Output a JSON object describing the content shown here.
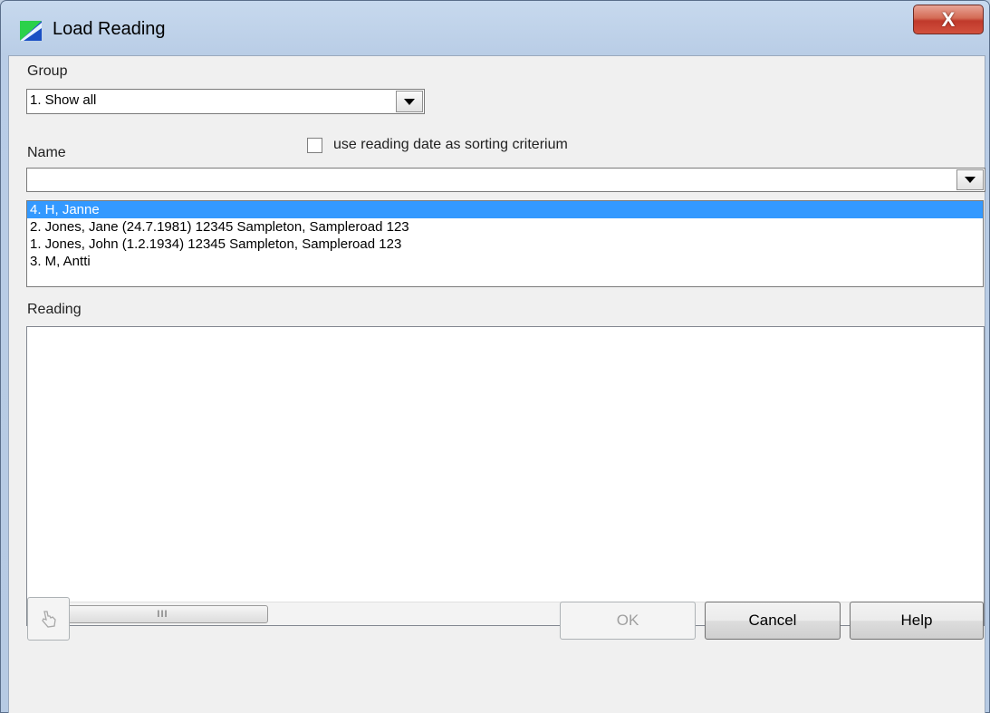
{
  "window": {
    "title": "Load Reading",
    "close_glyph": "X",
    "app_icon": "app-logo-icon"
  },
  "group": {
    "label": "Group",
    "selected": "1. Show all"
  },
  "name": {
    "label": "Name",
    "value": "",
    "sort_checkbox_label": "use reading date as sorting criterium",
    "sort_checkbox_checked": false,
    "options": [
      "4. H, Janne",
      "2. Jones, Jane (24.7.1981) 12345 Sampleton, Sampleroad 123",
      "1. Jones, John (1.2.1934) 12345 Sampleton, Sampleroad 123",
      "3. M, Antti"
    ],
    "selected_index": 0
  },
  "reading": {
    "label": "Reading",
    "scroll_grip": "III"
  },
  "buttons": {
    "ok": "OK",
    "cancel": "Cancel",
    "help": "Help",
    "tool_icon": "hand-pointer-icon"
  },
  "colors": {
    "selection": "#3399ff",
    "close": "#c0392b"
  }
}
